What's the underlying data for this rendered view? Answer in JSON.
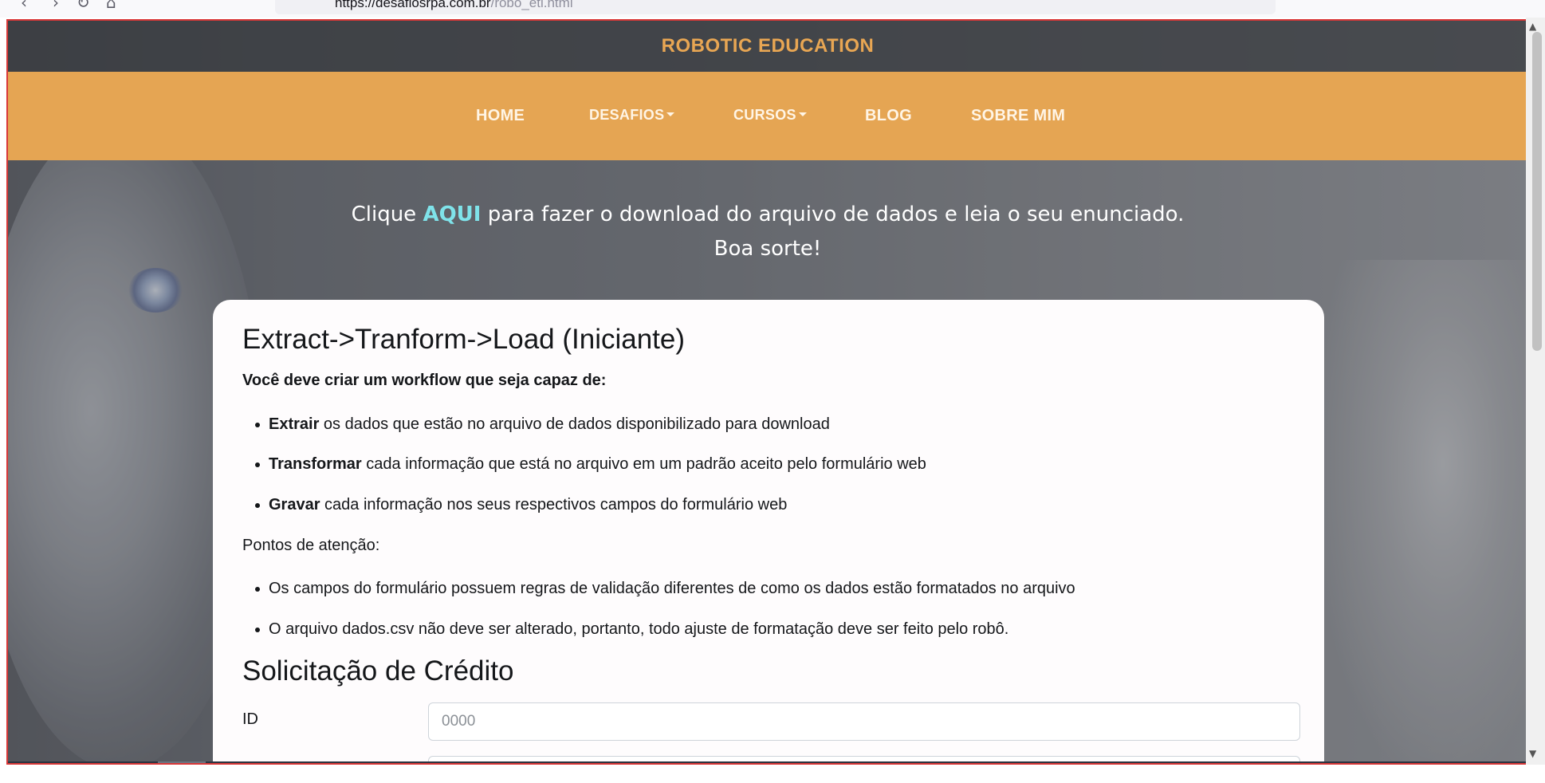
{
  "browser": {
    "url_host": "https://desafiosrpa.com.br",
    "url_path": "/robo_etl.html",
    "back_glyph": "‹",
    "forward_glyph": "›",
    "reload_glyph": "↻",
    "home_glyph": "⌂"
  },
  "site": {
    "title": "ROBOTIC EDUCATION",
    "accent_color": "#e5a553"
  },
  "nav": {
    "home": "HOME",
    "desafios": "DESAFIOS",
    "cursos": "CURSOS",
    "blog": "BLOG",
    "sobre": "SOBRE MIM"
  },
  "intro": {
    "prefix": "Clique ",
    "link": "AQUI",
    "suffix": " para fazer o download do arquivo de dados e leia o seu enunciado.",
    "line2": "Boa sorte!"
  },
  "card": {
    "title": "Extract->Tranform->Load (Iniciante)",
    "lead": "Você deve criar um workflow que seja capaz de:",
    "steps": [
      {
        "bold": "Extrair",
        "text": " os dados que estão no arquivo de dados disponibilizado para download"
      },
      {
        "bold": "Transformar",
        "text": " cada informação que está no arquivo em um padrão aceito pelo formulário web"
      },
      {
        "bold": "Gravar",
        "text": " cada informação nos seus respectivos campos do formulário web"
      }
    ],
    "attention_title": "Pontos de atenção:",
    "attention": [
      "Os campos do formulário possuem regras de validação diferentes de como os dados estão formatados no arquivo",
      "O arquivo dados.csv não deve ser alterado, portanto, todo ajuste de formatação deve ser feito pelo robô."
    ]
  },
  "form": {
    "title": "Solicitação de Crédito",
    "id_label": "ID",
    "id_placeholder": "0000"
  }
}
